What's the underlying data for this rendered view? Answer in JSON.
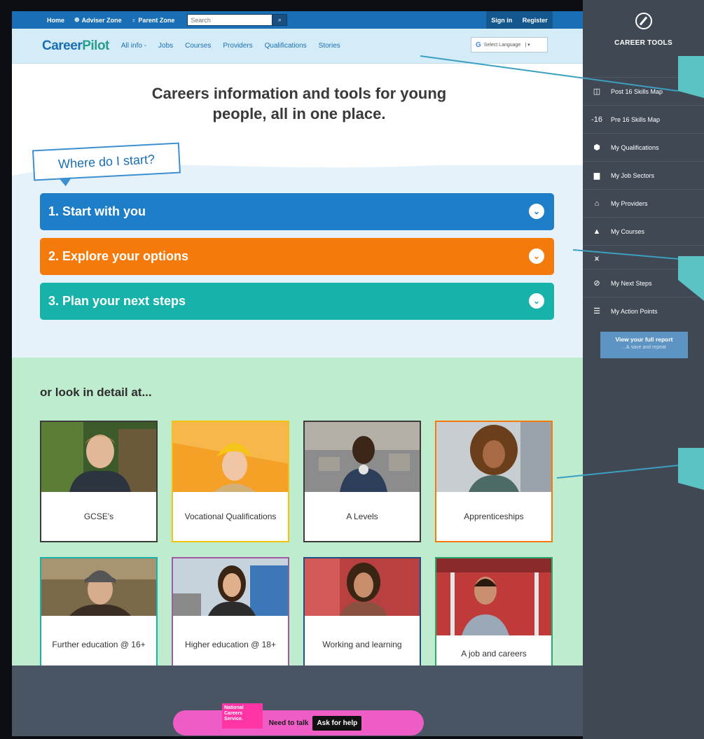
{
  "topbar": {
    "home": "Home",
    "adviser_zone": "Adviser Zone",
    "parent_zone": "Parent Zone",
    "search_placeholder": "Search",
    "sign_in": "Sign in",
    "register": "Register"
  },
  "nav": {
    "logo_career": "Career",
    "logo_pilot": "Pilot",
    "items": [
      "All info -",
      "Jobs",
      "Courses",
      "Providers",
      "Qualifications",
      "Stories"
    ],
    "translate": "Select Language"
  },
  "hero": {
    "title_line1": "Careers information and tools for young",
    "title_line2": "people, all in one place.",
    "where_tag": "Where do I start?"
  },
  "accordions": [
    {
      "label": "1. Start with you",
      "color": "#1e7ec8"
    },
    {
      "label": "2. Explore your options",
      "color": "#f47b0b"
    },
    {
      "label": "3. Plan your next steps",
      "color": "#17b3aa"
    }
  ],
  "detail": {
    "title": "or look in detail at...",
    "cards": [
      {
        "label": "GCSE's"
      },
      {
        "label": "Vocational Qualifications"
      },
      {
        "label": "A Levels"
      },
      {
        "label": "Apprenticeships"
      },
      {
        "label": "Further education @ 16+"
      },
      {
        "label": "Higher education @ 18+"
      },
      {
        "label": "Working and learning"
      },
      {
        "label": "A job and careers"
      }
    ]
  },
  "footer": {
    "ncs": "National Careers Service.",
    "need_to_talk": "Need to talk",
    "ask_for_help": "Ask for help"
  },
  "tools": {
    "title": "CAREER TOOLS",
    "items": [
      {
        "icon": "map-icon",
        "label": "Post 16 Skills Map"
      },
      {
        "icon": "pre16-icon",
        "glyph": "-16",
        "label": "Pre 16 Skills Map"
      },
      {
        "icon": "badge-icon",
        "label": "My Qualifications"
      },
      {
        "icon": "briefcase-icon",
        "label": "My Job Sectors"
      },
      {
        "icon": "institution-icon",
        "label": "My Providers"
      },
      {
        "icon": "graduation-cap-icon",
        "label": "My Courses"
      },
      {
        "icon": "graph-icon",
        "label": ""
      },
      {
        "icon": "compass-icon",
        "label": "My Next Steps"
      },
      {
        "icon": "list-icon",
        "label": "My Action Points"
      }
    ],
    "report": "View your full report",
    "report_sub": "...& save and repeat"
  }
}
